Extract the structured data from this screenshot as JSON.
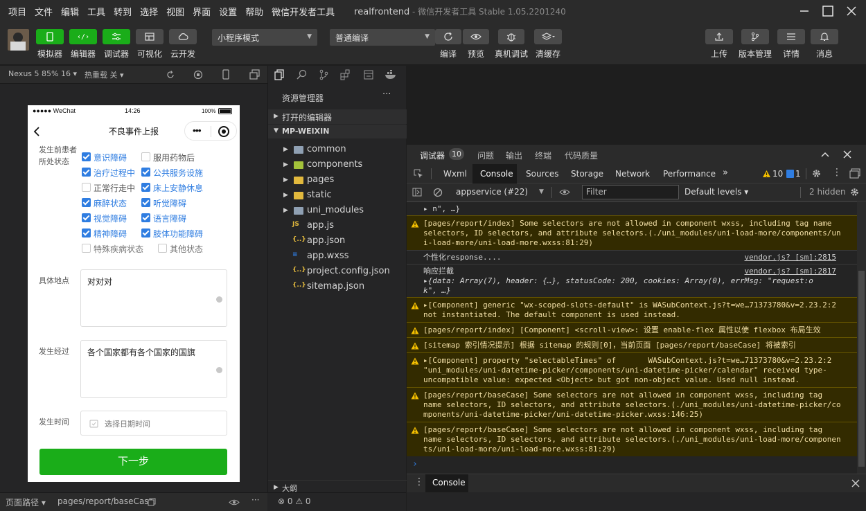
{
  "menu": [
    "项目",
    "文件",
    "编辑",
    "工具",
    "转到",
    "选择",
    "视图",
    "界面",
    "设置",
    "帮助",
    "微信开发者工具"
  ],
  "window_title": {
    "app": "realfrontend",
    "rest": " - 微信开发者工具 Stable 1.05.2201240"
  },
  "toolbar": {
    "simulator": "模拟器",
    "editor": "编辑器",
    "debugger": "调试器",
    "visual": "可视化",
    "cloud": "云开发",
    "mode_select": "小程序模式",
    "compile_select": "普通编译",
    "compile": "编译",
    "preview": "预览",
    "remote_debug": "真机调试",
    "clear_cache": "清缓存",
    "upload": "上传",
    "version": "版本管理",
    "details": "详情",
    "messages": "消息"
  },
  "simbar": {
    "device": "Nexus 5 85% 16 ▾",
    "hotreload": "热重载 关 ▾"
  },
  "phone": {
    "status_left": "●●●●● WeChat",
    "status_time": "14:26",
    "status_right": "100%",
    "page_title": "不良事件上报",
    "state_label": "发生前患者所处状态",
    "options": [
      {
        "text": "意识障碍",
        "checked": true
      },
      {
        "text": "服用药物后",
        "checked": false
      },
      {
        "text": "治疗过程中",
        "checked": true
      },
      {
        "text": "公共服务设施",
        "checked": true
      },
      {
        "text": "正常行走中",
        "checked": false
      },
      {
        "text": "床上安静休息",
        "checked": true
      },
      {
        "text": "麻醉状态",
        "checked": true
      },
      {
        "text": "听觉障碍",
        "checked": true
      },
      {
        "text": "视觉障碍",
        "checked": true
      },
      {
        "text": "语言障碍",
        "checked": true
      },
      {
        "text": "精神障碍",
        "checked": true
      },
      {
        "text": "肢体功能障碍",
        "checked": true
      },
      {
        "text": "特殊疾病状态",
        "checked": false
      },
      {
        "text": "其他状态",
        "checked": false
      }
    ],
    "location_label": "具体地点",
    "location_value": "对对对",
    "process_label": "发生经过",
    "process_value": "各个国家都有各个国家的国旗",
    "time_label": "发生时间",
    "time_placeholder": "选择日期时间",
    "next_button": "下一步"
  },
  "pathbar": {
    "label": "页面路径 ▾",
    "path": "pages/report/baseCase"
  },
  "explorer": {
    "title": "资源管理器",
    "open_editors": "打开的编辑器",
    "project": "MP-WEIXIN",
    "folders": [
      "common",
      "components",
      "pages",
      "static",
      "uni_modules"
    ],
    "files": [
      "app.js",
      "app.json",
      "app.wxss",
      "project.config.json",
      "sitemap.json"
    ],
    "outline": "大纲",
    "problems": "⊗ 0 ⚠ 0"
  },
  "devtools": {
    "top_tabs": [
      "调试器",
      "问题",
      "输出",
      "终端",
      "代码质量"
    ],
    "badge": "10",
    "tabs": [
      "Wxml",
      "Console",
      "Sources",
      "Storage",
      "Network",
      "Performance",
      "»"
    ],
    "warn_count": "10",
    "info_count": "1",
    "context": "appservice (#22)",
    "filter_placeholder": "Filter",
    "levels": "Default levels ▾",
    "hidden": "2 hidden",
    "drawer_tab": "Console",
    "prompt": "›"
  },
  "console": [
    {
      "type": "log",
      "text": "▸ n\", …}",
      "src": ""
    },
    {
      "type": "warn",
      "lines": [
        "[pages/report/index] Some selectors are not allowed in component wxss, including tag name",
        "selectors, ID selectors, and attribute selectors.(./uni_modules/uni-load-more/components/un",
        "i-load-more/uni-load-more.wxss:81:29)"
      ]
    },
    {
      "type": "log",
      "text": "个性化response....",
      "src": "vendor.js? [sm]:2815"
    },
    {
      "type": "log",
      "text": "响应拦截",
      "src": "vendor.js? [sm]:2817",
      "sub": [
        "▸{data: Array(7), header: {…}, statusCode: 200, cookies: Array(0), errMsg: \"request:o",
        "k\", …}"
      ]
    },
    {
      "type": "warn",
      "lines": [
        "▸[Component] generic \"wx-scoped-slots-default\" is WASubContext.js?t=we…71373780&v=2.23.2:2",
        "not instantiated. The default component is used instead."
      ]
    },
    {
      "type": "warn",
      "lines": [
        "[pages/report/index] [Component] <scroll-view>: 设置 enable-flex 属性以使 flexbox 布局生效"
      ]
    },
    {
      "type": "warn",
      "lines": [
        "[sitemap 索引情况提示] 根据 sitemap 的规则[0]，当前页面 [pages/report/baseCase] 将被索引"
      ]
    },
    {
      "type": "warn",
      "lines": [
        "▸[Component] property \"selectableTimes\" of       WASubContext.js?t=we…71373780&v=2.23.2:2",
        "\"uni_modules/uni-datetime-picker/components/uni-datetime-picker/calendar\" received type-",
        "uncompatible value: expected <Object> but got non-object value. Used null instead."
      ]
    },
    {
      "type": "warn",
      "lines": [
        "[pages/report/baseCase] Some selectors are not allowed in component wxss, including tag",
        "name selectors, ID selectors, and attribute selectors.(./uni_modules/uni-datetime-picker/co",
        "mponents/uni-datetime-picker/uni-datetime-picker.wxss:146:25)"
      ]
    },
    {
      "type": "warn",
      "lines": [
        "[pages/report/baseCase] Some selectors are not allowed in component wxss, including tag",
        "name selectors, ID selectors, and attribute selectors.(./uni_modules/uni-load-more/componen",
        "ts/uni-load-more/uni-load-more.wxss:81:29)"
      ]
    }
  ],
  "colors": {
    "green": "#1aad19",
    "blue": "#2f7de1",
    "warn_bg": "#332b00",
    "warn_text": "#f2dfa6",
    "dark": "#1e1e1e"
  }
}
